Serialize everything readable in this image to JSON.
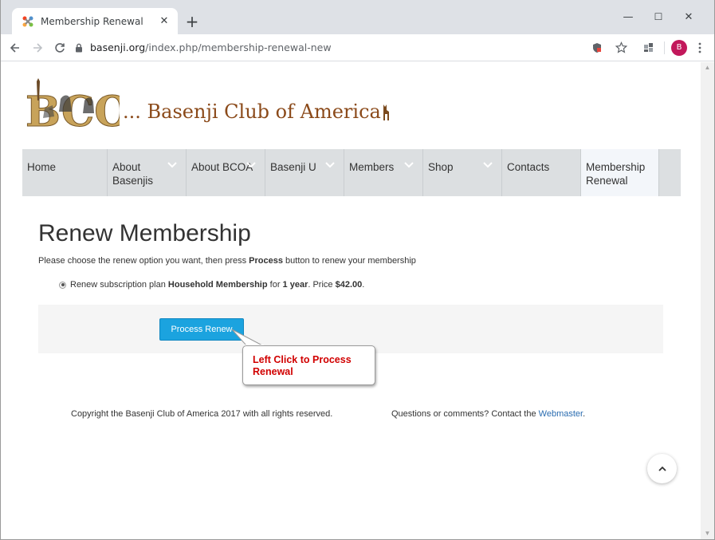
{
  "browser": {
    "tab_title": "Membership Renewal",
    "tab_close": "✕",
    "new_tab": "+",
    "window_controls": {
      "minimize": "—",
      "maximize": "☐",
      "close": "✕"
    },
    "url_host": "basenji.org",
    "url_path": "/index.php/membership-renewal-new",
    "profile_initial": "B"
  },
  "site": {
    "logo_letters": "BCOA",
    "logo_text": "... Basenji Club of America"
  },
  "nav": {
    "items": [
      {
        "label": "Home",
        "has_dropdown": false
      },
      {
        "label": "About\nBasenjis",
        "has_dropdown": true
      },
      {
        "label": "About BCOA",
        "has_dropdown": true
      },
      {
        "label": "Basenji U",
        "has_dropdown": true
      },
      {
        "label": "Members",
        "has_dropdown": true
      },
      {
        "label": "Shop",
        "has_dropdown": true
      },
      {
        "label": "Contacts",
        "has_dropdown": false
      },
      {
        "label": "Membership\nRenewal",
        "has_dropdown": false,
        "active": true
      }
    ]
  },
  "main": {
    "title": "Renew Membership",
    "instructions_pre": "Please choose the renew option you want, then press ",
    "instructions_bold": "Process",
    "instructions_post": " button to renew your membership",
    "plan_pre": "Renew subscription plan ",
    "plan_name": "Household Membership",
    "plan_mid": " for ",
    "plan_term": "1 year",
    "plan_price_pre": ". Price ",
    "plan_price": "$42.00",
    "plan_end": ".",
    "process_button": "Process Renew"
  },
  "callout": {
    "text": "Left Click to Process Renewal"
  },
  "footer": {
    "copyright": "Copyright the Basenji Club of America 2017 with all rights reserved.",
    "contact_pre": "Questions or comments? Contact the ",
    "contact_link": "Webmaster",
    "contact_post": "."
  },
  "colors": {
    "accent_button": "#1ba3df",
    "callout_text": "#d10000",
    "logo_brown": "#8b4a1a",
    "link": "#2a6cb0"
  }
}
